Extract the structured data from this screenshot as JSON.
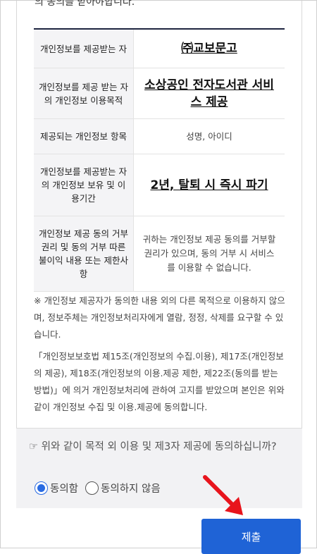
{
  "intro_text": "의 동의를 받아야합니다.",
  "table": {
    "rows": [
      {
        "label": "개인정보를 제공받는 자",
        "value": "㈜교보문고",
        "style": "big"
      },
      {
        "label": "개인정보를 제공 받는 자의 개인정보 이용목적",
        "value": "소상공인 전자도서관 서비스 제공",
        "style": "big"
      },
      {
        "label": "제공되는 개인정보 항목",
        "value": "성명, 아이디",
        "style": "normal"
      },
      {
        "label": "개인정보를 제공받는 자의 개인정보 보유 및 이용기간",
        "value": "2년, 탈퇴 시 즉시 파기",
        "style": "big"
      },
      {
        "label": "개인정보 제공 동의 거부 권리 및 동의 거부 따른 불이익 내용 또는 제한사항",
        "value": "귀하는 개인정보 제공 동의를 거부할 권리가 있으며, 동의 거부 시 서비스를 이용할 수 없습니다.",
        "style": "normal"
      }
    ]
  },
  "note1": "※ 개인정보 제공자가 동의한 내용 외의 다른 목적으로 이용하지 않으며, 정보주체는 개인정보처리자에게 열람, 정정, 삭제를 요구할 수 있습니다.",
  "note2": "「개인정보보호법 제15조(개인정보의 수집.이용), 제17조(개인정보의 제공), 제18조(개인정보의 이용.제공 제한, 제22조(동의를 받는 방법)」에 의거 개인정보처리에 관하여 고지를 받았으며 본인은 위와 같이 개인정보 수집 및 이용.제공에 동의합니다.",
  "question": "☞ 위와 같이 목적 외 이용 및 제3자 제공에 동의하십니까?",
  "radios": {
    "agree_label": "동의함",
    "disagree_label": "동의하지 않음",
    "selected": "agree"
  },
  "submit_label": "제출",
  "colors": {
    "accent": "#1f63d6",
    "radio": "#2a6be2",
    "arrow": "#e8141c",
    "table_header_line": "#1e2540"
  }
}
